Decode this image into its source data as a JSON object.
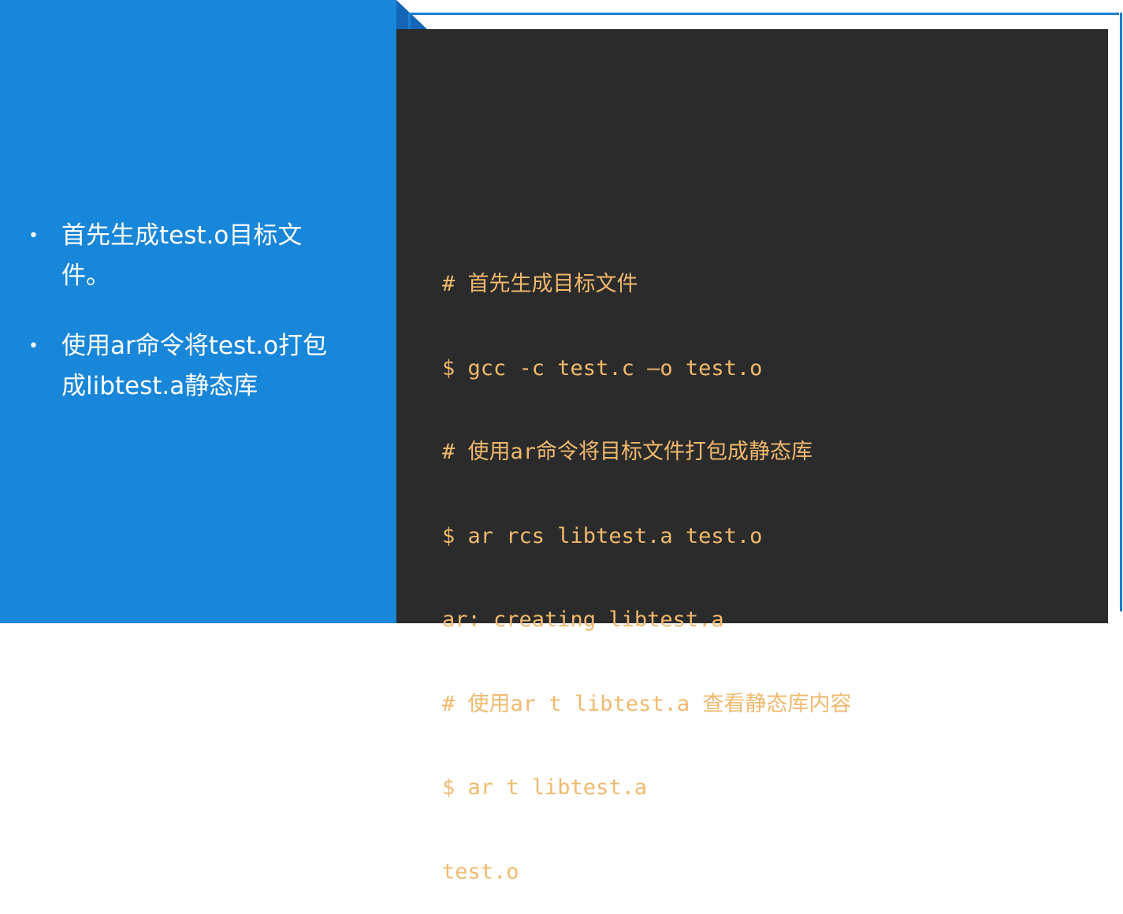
{
  "bullets": [
    "首先生成test.o目标文件。",
    "使用ar命令将test.o打包成libtest.a静态库"
  ],
  "bullet_symbol": "•",
  "code_lines": [
    "# 首先生成目标文件",
    "$ gcc -c test.c —o test.o",
    "# 使用ar命令将目标文件打包成静态库",
    "$ ar rcs libtest.a test.o",
    "ar: creating libtest.a",
    "# 使用ar t libtest.a 查看静态库内容",
    "$ ar t libtest.a",
    "test.o"
  ],
  "colors": {
    "left_panel": "#1886d9",
    "accent_dark": "#1565b6",
    "code_background": "#2b2b2b",
    "code_text": "#f0b96e",
    "frame": "#1a7fd1"
  }
}
